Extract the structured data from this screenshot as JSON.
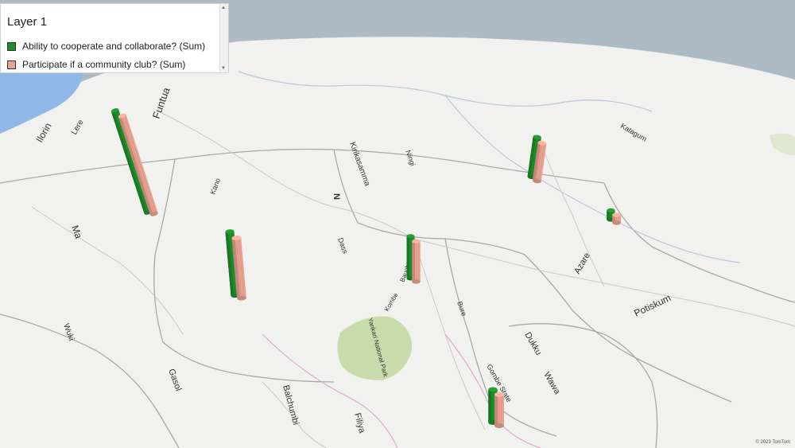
{
  "legend": {
    "title": "Layer 1",
    "series": [
      {
        "name": "Ability to cooperate and collaborate? (Sum)",
        "color": "#1f8f2a"
      },
      {
        "name": "Participate if a community club? (Sum)",
        "color": "#e9a291"
      }
    ]
  },
  "map": {
    "labels": [
      {
        "text": "Kano"
      },
      {
        "text": "Funtua"
      },
      {
        "text": "Azare"
      },
      {
        "text": "Potiskum"
      },
      {
        "text": "Bauchi"
      },
      {
        "text": "Gombe State"
      },
      {
        "text": "Dukku"
      },
      {
        "text": "Wawa"
      },
      {
        "text": "Balchumbi"
      },
      {
        "text": "Gasol"
      },
      {
        "text": "Filiya"
      },
      {
        "text": "Yankari National Park"
      },
      {
        "text": "Kirikasamma"
      },
      {
        "text": "Ningi"
      },
      {
        "text": "Bure"
      },
      {
        "text": "Wuki"
      },
      {
        "text": "Ma"
      },
      {
        "text": "Ilorin"
      },
      {
        "text": "Katagum"
      },
      {
        "text": "Kombe"
      },
      {
        "text": "Lere"
      },
      {
        "text": "Dass"
      },
      {
        "text": "N"
      }
    ],
    "copyright": "© 2023 TomTom"
  },
  "columns": [
    {
      "id": "col-kaduna",
      "cooperate": 100,
      "participate": 98
    },
    {
      "id": "col-plateau",
      "cooperate": 52,
      "participate": 50
    },
    {
      "id": "col-bauchi",
      "cooperate": 38,
      "participate": 37
    },
    {
      "id": "col-jigawa",
      "cooperate": 35,
      "participate": 34
    },
    {
      "id": "col-yobe",
      "cooperate": 8,
      "participate": 7
    },
    {
      "id": "col-gombe",
      "cooperate": 26,
      "participate": 25
    }
  ]
}
